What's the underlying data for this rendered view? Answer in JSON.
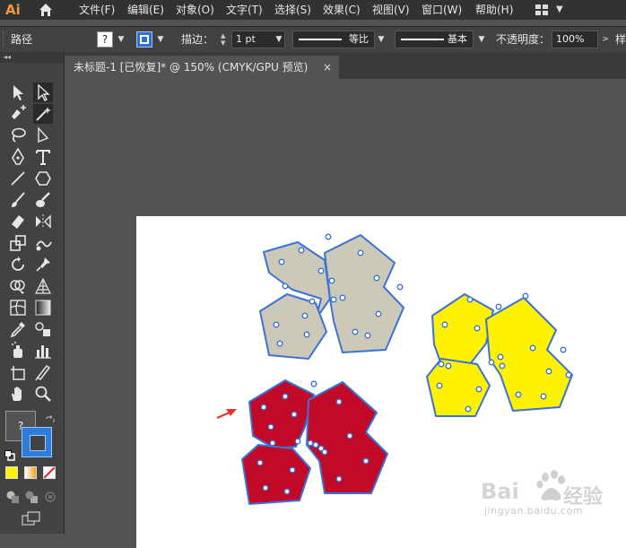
{
  "app": {
    "logo": "Ai"
  },
  "menu": {
    "items": [
      "文件(F)",
      "编辑(E)",
      "对象(O)",
      "文字(T)",
      "选择(S)",
      "效果(C)",
      "视图(V)",
      "窗口(W)",
      "帮助(H)"
    ]
  },
  "control": {
    "label_path": "路径",
    "fill_question": "?",
    "stroke_label": "描边：",
    "stroke_weight": "1 pt",
    "profile_label": "等比",
    "brush_label": "基本",
    "opacity_label": "不透明度：",
    "opacity_value": "100%",
    "style_cut": "样"
  },
  "toolbar": {
    "collapse": "◂◂",
    "swatch_question": "?"
  },
  "document": {
    "tab_title": "未标题-1 [已恢复]* @ 150% (CMYK/GPU 预览)",
    "close": "×"
  },
  "colors": {
    "gray_fill": "#cdc9b8",
    "yellow_fill": "#fff200",
    "red_fill": "#c10a28",
    "selection": "#3a73d6",
    "arrow": "#e8352a"
  },
  "watermark": {
    "brand": "Bai",
    "brand_cn": "经验",
    "url": "jingyan.baidu.com"
  }
}
